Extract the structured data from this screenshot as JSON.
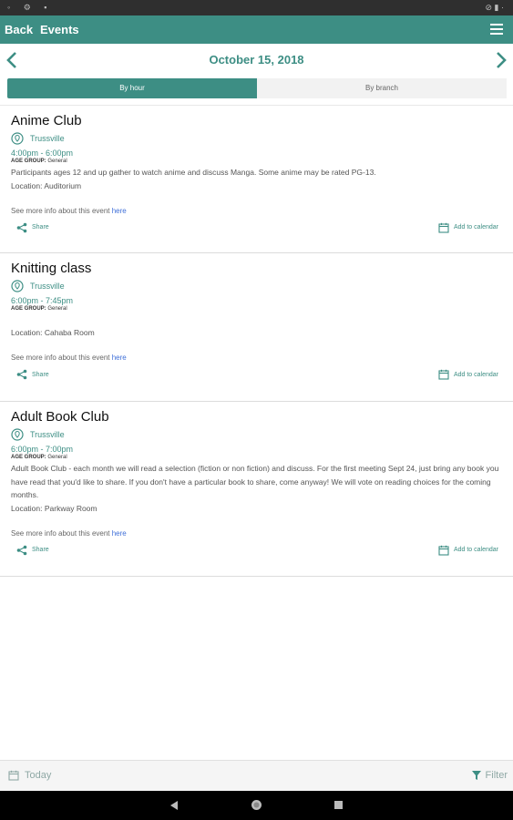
{
  "status_bar": {
    "left_icons": [
      "notification-icon",
      "settings-icon",
      "lock-icon"
    ],
    "right_icons": [
      "no-sim-icon",
      "battery-icon"
    ]
  },
  "app_bar": {
    "back_label": "Back",
    "title": "Events"
  },
  "date_nav": {
    "date": "October 15, 2018"
  },
  "segments": {
    "by_hour": "By hour",
    "by_branch": "By branch",
    "selected": "By hour"
  },
  "events": [
    {
      "name": "Anime Club",
      "branch": "Trussville",
      "time": "4:00pm - 6:00pm",
      "age_label": "AGE GROUP:",
      "age_value": "General",
      "description": "Participants ages 12 and up gather to watch anime and discuss Manga. Some anime may be rated PG-13.",
      "location": "Location: Auditorium",
      "more_text": "See more info about this event ",
      "more_link": "here",
      "share_label": "Share",
      "calendar_label": "Add to calendar"
    },
    {
      "name": "Knitting class",
      "branch": "Trussville",
      "time": "6:00pm - 7:45pm",
      "age_label": "AGE GROUP:",
      "age_value": "General",
      "description": "",
      "location": "Location: Cahaba Room",
      "more_text": "See more info about this event ",
      "more_link": "here",
      "share_label": "Share",
      "calendar_label": "Add to calendar"
    },
    {
      "name": "Adult Book Club",
      "branch": "Trussville",
      "time": "6:00pm - 7:00pm",
      "age_label": "AGE GROUP:",
      "age_value": "General",
      "description": "Adult Book Club - each month we will read a selection (fiction or non fiction) and discuss. For the first meeting Sept 24, just bring any book you have read that you'd like to share. If you don't have a particular book to share, come anyway! We will vote on reading choices for the coming months.",
      "location": "Location: Parkway Room",
      "more_text": "See more info about this event ",
      "more_link": "here",
      "share_label": "Share",
      "calendar_label": "Add to calendar"
    }
  ],
  "bottom_bar": {
    "today_label": "Today",
    "filter_label": "Filter"
  },
  "colors": {
    "accent": "#3d8e84",
    "link": "#3f6fd8",
    "nav_background": "#000000"
  }
}
